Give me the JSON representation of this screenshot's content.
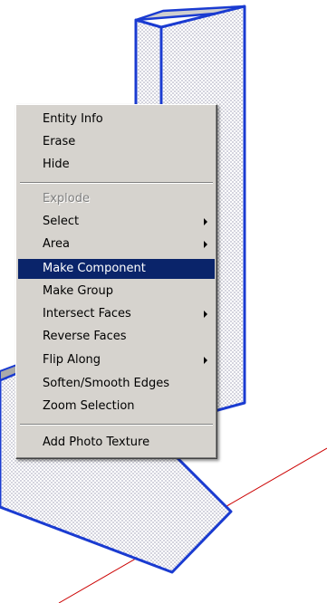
{
  "context_menu": {
    "items": [
      {
        "label": "Entity Info"
      },
      {
        "label": "Erase"
      },
      {
        "label": "Hide"
      },
      {
        "label": "Explode",
        "disabled": true
      },
      {
        "label": "Select",
        "submenu": true
      },
      {
        "label": "Area",
        "submenu": true
      },
      {
        "label": "Make Component",
        "highlighted": true
      },
      {
        "label": "Make Group"
      },
      {
        "label": "Intersect Faces",
        "submenu": true
      },
      {
        "label": "Reverse Faces"
      },
      {
        "label": "Flip Along",
        "submenu": true
      },
      {
        "label": "Soften/Smooth Edges"
      },
      {
        "label": "Zoom Selection"
      },
      {
        "label": "Add Photo Texture"
      }
    ]
  },
  "colors": {
    "selection_edge": "#1a3bd1",
    "menu_background": "#d6d3ce",
    "menu_highlight": "#0a246a",
    "axis_red": "#cc0000"
  }
}
